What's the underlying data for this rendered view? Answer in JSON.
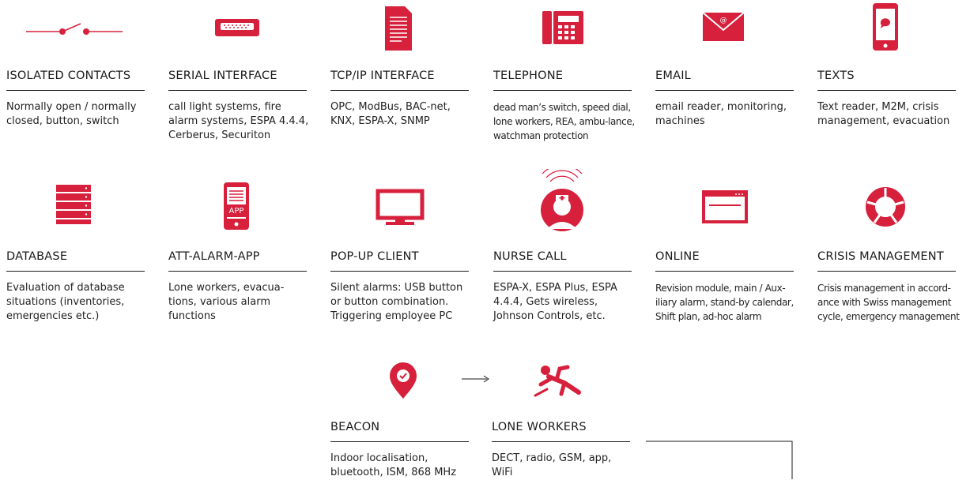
{
  "accent_color": "#d6203c",
  "cards": [
    {
      "id": "isolated-contacts",
      "icon": "switch-icon",
      "title": "ISOLATED CONTACTS",
      "desc": "Normally open / normally closed, button, switch"
    },
    {
      "id": "serial-interface",
      "icon": "serial-port-icon",
      "title": "SERIAL INTERFACE",
      "desc": "call light systems, fire alarm systems, ESPA 4.4.4, Cerberus, Securiton"
    },
    {
      "id": "tcpip-interface",
      "icon": "document-icon",
      "title": "TCP/IP INTERFACE",
      "desc": "OPC, ModBus, BAC-net, KNX, ESPA-X, SNMP"
    },
    {
      "id": "telephone",
      "icon": "telephone-icon",
      "title": "TELEPHONE",
      "desc": "dead man’s switch, speed dial, lone workers, REA, ambu-lance, watchman protection"
    },
    {
      "id": "email",
      "icon": "envelope-icon",
      "title": "EMAIL",
      "desc": "email reader, monitoring, machines"
    },
    {
      "id": "texts",
      "icon": "smartphone-message-icon",
      "title": "TEXTS",
      "desc": "Text reader, M2M, crisis management, evacuation"
    },
    {
      "id": "database",
      "icon": "database-icon",
      "title": "DATABASE",
      "desc": "Evaluation of database situations (inventories, emergencies etc.)"
    },
    {
      "id": "att-alarm-app",
      "icon": "app-phone-icon",
      "title": "ATT-ALARM-APP",
      "desc": "Lone workers, evacua-tions, various alarm functions",
      "app_label": "APP"
    },
    {
      "id": "popup-client",
      "icon": "monitor-icon",
      "title": "POP-UP CLIENT",
      "desc": "Silent alarms: USB button or button combination. Triggering employee PC"
    },
    {
      "id": "nurse-call",
      "icon": "nurse-icon",
      "title": "NURSE CALL",
      "desc": "ESPA-X, ESPA Plus, ESPA 4.4.4, Gets wireless, Johnson Controls, etc."
    },
    {
      "id": "online",
      "icon": "browser-window-icon",
      "title": "ONLINE",
      "desc": "Revision module, main / Aux-iliary alarm, stand-by calendar, Shift plan, ad-hoc alarm"
    },
    {
      "id": "crisis-management",
      "icon": "cycle-icon",
      "title": "CRISIS MANAGEMENT",
      "desc": "Crisis management in accord-ance with Swiss management cycle, emergency management"
    },
    {
      "id": "beacon",
      "icon": "location-pin-icon",
      "title": "BEACON",
      "desc": "Indoor localisation, bluetooth, ISM, 868 MHz"
    },
    {
      "id": "lone-workers",
      "icon": "falling-person-icon",
      "title": "LONE WORKERS",
      "desc": "DECT, radio, GSM, app, WiFi"
    }
  ]
}
